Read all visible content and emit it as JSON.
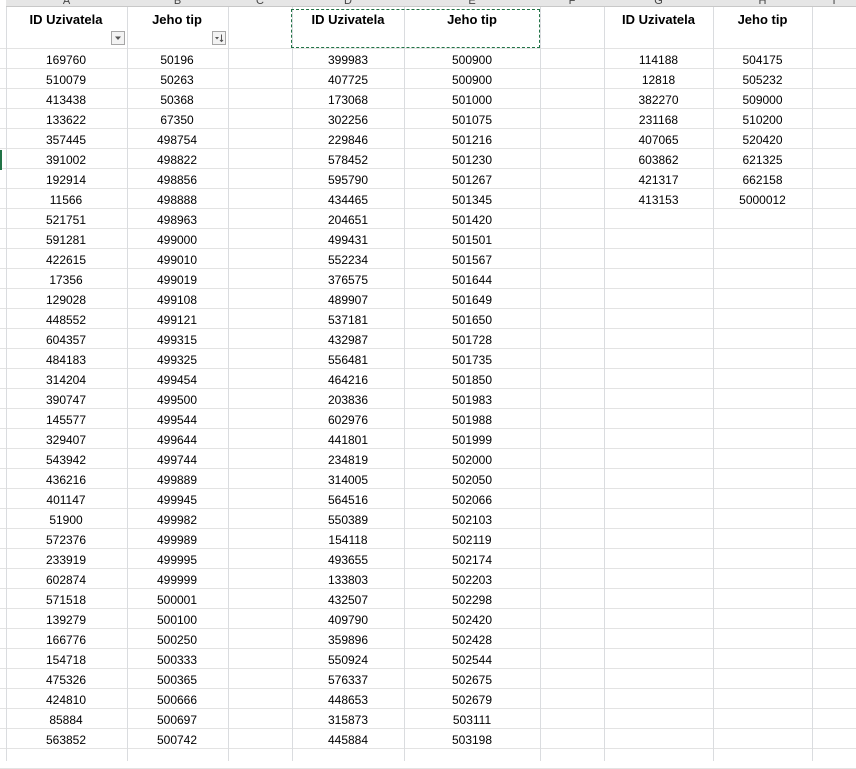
{
  "column_letters": [
    "A",
    "B",
    "C",
    "D",
    "E",
    "F",
    "G",
    "H",
    "I"
  ],
  "header_a": "ID Uzivatela",
  "header_b": "Jeho tip",
  "header_d": "ID Uzivatela",
  "header_e": "Jeho tip",
  "header_g": "ID Uzivatela",
  "header_h": "Jeho tip",
  "filter_a_icon": "dropdown-arrow-icon",
  "filter_b_icon": "sort-ascending-filter-icon",
  "selection_color": "#217346",
  "table1": [
    [
      "169760",
      "50196"
    ],
    [
      "510079",
      "50263"
    ],
    [
      "413438",
      "50368"
    ],
    [
      "133622",
      "67350"
    ],
    [
      "357445",
      "498754"
    ],
    [
      "391002",
      "498822"
    ],
    [
      "192914",
      "498856"
    ],
    [
      "11566",
      "498888"
    ],
    [
      "521751",
      "498963"
    ],
    [
      "591281",
      "499000"
    ],
    [
      "422615",
      "499010"
    ],
    [
      "17356",
      "499019"
    ],
    [
      "129028",
      "499108"
    ],
    [
      "448552",
      "499121"
    ],
    [
      "604357",
      "499315"
    ],
    [
      "484183",
      "499325"
    ],
    [
      "314204",
      "499454"
    ],
    [
      "390747",
      "499500"
    ],
    [
      "145577",
      "499544"
    ],
    [
      "329407",
      "499644"
    ],
    [
      "543942",
      "499744"
    ],
    [
      "436216",
      "499889"
    ],
    [
      "401147",
      "499945"
    ],
    [
      "51900",
      "499982"
    ],
    [
      "572376",
      "499989"
    ],
    [
      "233919",
      "499995"
    ],
    [
      "602874",
      "499999"
    ],
    [
      "571518",
      "500001"
    ],
    [
      "139279",
      "500100"
    ],
    [
      "166776",
      "500250"
    ],
    [
      "154718",
      "500333"
    ],
    [
      "475326",
      "500365"
    ],
    [
      "424810",
      "500666"
    ],
    [
      "85884",
      "500697"
    ],
    [
      "563852",
      "500742"
    ]
  ],
  "table2": [
    [
      "399983",
      "500900"
    ],
    [
      "407725",
      "500900"
    ],
    [
      "173068",
      "501000"
    ],
    [
      "302256",
      "501075"
    ],
    [
      "229846",
      "501216"
    ],
    [
      "578452",
      "501230"
    ],
    [
      "595790",
      "501267"
    ],
    [
      "434465",
      "501345"
    ],
    [
      "204651",
      "501420"
    ],
    [
      "499431",
      "501501"
    ],
    [
      "552234",
      "501567"
    ],
    [
      "376575",
      "501644"
    ],
    [
      "489907",
      "501649"
    ],
    [
      "537181",
      "501650"
    ],
    [
      "432987",
      "501728"
    ],
    [
      "556481",
      "501735"
    ],
    [
      "464216",
      "501850"
    ],
    [
      "203836",
      "501983"
    ],
    [
      "602976",
      "501988"
    ],
    [
      "441801",
      "501999"
    ],
    [
      "234819",
      "502000"
    ],
    [
      "314005",
      "502050"
    ],
    [
      "564516",
      "502066"
    ],
    [
      "550389",
      "502103"
    ],
    [
      "154118",
      "502119"
    ],
    [
      "493655",
      "502174"
    ],
    [
      "133803",
      "502203"
    ],
    [
      "432507",
      "502298"
    ],
    [
      "409790",
      "502420"
    ],
    [
      "359896",
      "502428"
    ],
    [
      "550924",
      "502544"
    ],
    [
      "576337",
      "502675"
    ],
    [
      "448653",
      "502679"
    ],
    [
      "315873",
      "503111"
    ],
    [
      "445884",
      "503198"
    ]
  ],
  "table3": [
    [
      "114188",
      "504175"
    ],
    [
      "12818",
      "505232"
    ],
    [
      "382270",
      "509000"
    ],
    [
      "231168",
      "510200"
    ],
    [
      "407065",
      "520420"
    ],
    [
      "603862",
      "621325"
    ],
    [
      "421317",
      "662158"
    ],
    [
      "413153",
      "5000012"
    ]
  ]
}
